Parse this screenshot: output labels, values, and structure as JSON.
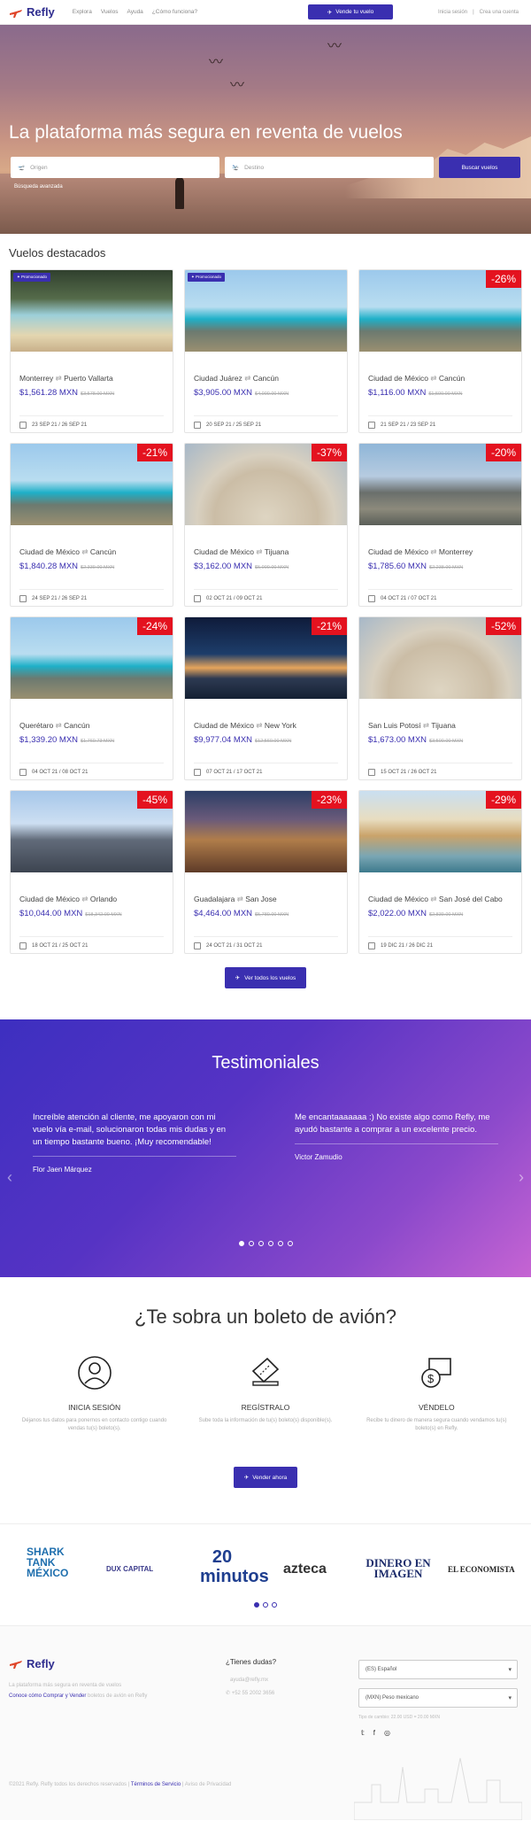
{
  "nav": {
    "brand": "Refly",
    "links": [
      "Explora",
      "Vuelos",
      "Ayuda",
      "¿Cómo funciona?"
    ],
    "sell": "Vende tu vuelo",
    "login": "Inicia sesión",
    "signup": "Crea una cuenta"
  },
  "hero": {
    "title": "La plataforma más segura en reventa de vuelos",
    "origin": "Origen",
    "dest": "Destino",
    "search": "Buscar vuelos",
    "advanced": "Búsqueda avanzada"
  },
  "featured": {
    "title": "Vuelos destacados",
    "promo": "Promocionado",
    "all": "Ver todos los vuelos",
    "cards": [
      {
        "from": "Monterrey",
        "to": "Puerto Vallarta",
        "price": "$1,561.28 MXN",
        "old": "$3,578.00 MXN",
        "dates": "23 SEP 21 / 26 SEP 21",
        "badge": "",
        "promo": true,
        "scene": "cave"
      },
      {
        "from": "Ciudad Juárez",
        "to": "Cancún",
        "price": "$3,905.00 MXN",
        "old": "$4,000.00 MXN",
        "dates": "20 SEP 21 / 25 SEP 21",
        "badge": "",
        "promo": true,
        "scene": "ruin"
      },
      {
        "from": "Ciudad de México",
        "to": "Cancún",
        "price": "$1,116.00 MXN",
        "old": "$1,500.00 MXN",
        "dates": "21 SEP 21 / 23 SEP 21",
        "badge": "-26%",
        "promo": false,
        "scene": "ruin"
      },
      {
        "from": "Ciudad de México",
        "to": "Cancún",
        "price": "$1,840.28 MXN",
        "old": "$2,339.00 MXN",
        "dates": "24 SEP 21 / 26 SEP 21",
        "badge": "-21%",
        "promo": false,
        "scene": "ruin"
      },
      {
        "from": "Ciudad de México",
        "to": "Tijuana",
        "price": "$3,162.00 MXN",
        "old": "$5,000.00 MXN",
        "dates": "02 OCT 21 / 09 OCT 21",
        "badge": "-37%",
        "promo": false,
        "scene": "dome"
      },
      {
        "from": "Ciudad de México",
        "to": "Monterrey",
        "price": "$1,785.60 MXN",
        "old": "$2,238.00 MXN",
        "dates": "04 OCT 21 / 07 OCT 21",
        "badge": "-20%",
        "promo": false,
        "scene": "mountain"
      },
      {
        "from": "Querétaro",
        "to": "Cancún",
        "price": "$1,339.20 MXN",
        "old": "$1,760.73 MXN",
        "dates": "04 OCT 21 / 08 OCT 21",
        "badge": "-24%",
        "promo": false,
        "scene": "ruin"
      },
      {
        "from": "Ciudad de México",
        "to": "New York",
        "price": "$9,977.04 MXN",
        "old": "$12,560.00 MXN",
        "dates": "07 OCT 21 / 17 OCT 21",
        "badge": "-21%",
        "promo": false,
        "scene": "city"
      },
      {
        "from": "San Luis Potosí",
        "to": "Tijuana",
        "price": "$1,673.00 MXN",
        "old": "$3,500.00 MXN",
        "dates": "15 OCT 21 / 26 OCT 21",
        "badge": "-52%",
        "promo": false,
        "scene": "dome"
      },
      {
        "from": "Ciudad de México",
        "to": "Orlando",
        "price": "$10,044.00 MXN",
        "old": "$18,342.00 MXN",
        "dates": "18 OCT 21 / 25 OCT 21",
        "badge": "-45%",
        "promo": false,
        "scene": "castle"
      },
      {
        "from": "Guadalajara",
        "to": "San Jose",
        "price": "$4,464.00 MXN",
        "old": "$5,780.00 MXN",
        "dates": "24 OCT 21 / 31 OCT 21",
        "badge": "-23%",
        "promo": false,
        "scene": "night"
      },
      {
        "from": "Ciudad de México",
        "to": "San José del Cabo",
        "price": "$2,022.00 MXN",
        "old": "$2,839.00 MXN",
        "dates": "19 DIC 21 / 26 DIC 21",
        "badge": "-29%",
        "promo": false,
        "scene": "arch"
      }
    ]
  },
  "testimonials": {
    "title": "Testimoniales",
    "items": [
      {
        "text": "Increíble atención al cliente, me apoyaron con mi vuelo vía e-mail, solucionaron todas mis dudas y en un tiempo bastante bueno. ¡Muy recomendable!",
        "author": "Flor Jaen Márquez"
      },
      {
        "text": "Me encantaaaaaaa :) No existe algo como Refly, me ayudó bastante a comprar a un excelente precio.",
        "author": "Victor Zamudio"
      }
    ]
  },
  "how": {
    "title": "¿Te sobra un boleto de avión?",
    "steps": [
      {
        "t": "INICIA SESIÓN",
        "d": "Déjanos tus datos para ponernos en contacto contigo cuando vendas tu(s) boleto(s)."
      },
      {
        "t": "REGÍSTRALO",
        "d": "Sube toda la información de tu(s) boleto(s) disponible(s)."
      },
      {
        "t": "VÉNDELO",
        "d": "Recibe tu dinero de manera segura cuando vendamos tu(s) boleto(s) en Refly."
      }
    ],
    "cta": "Vender ahora"
  },
  "press": [
    "SHARK TANK MÉXICO",
    "DUX CAPITAL",
    "20 minutos",
    "azteca",
    "DINERO EN IMAGEN",
    "EL ECONOMISTA"
  ],
  "footer": {
    "brand": "Refly",
    "tagline": "La plataforma más segura en reventa de vuelos",
    "sub1": "Conoce cómo Comprar y Vender",
    "sub2": "boletos de avión en Refly",
    "q": "¿Tienes dudas?",
    "email": "ayuda@refly.mx",
    "phone": "+52 55 2002 3656",
    "lang": "(ES) Español",
    "cur": "(MXN) Peso mexicano",
    "rate": "Tipo de cambio: 22.00 USD = 20.00 MXN",
    "copy": "©2021 Refly. Refly todos los derechos reservados",
    "terms": "Términos de Servicio",
    "privacy": "Aviso de Privacidad"
  }
}
